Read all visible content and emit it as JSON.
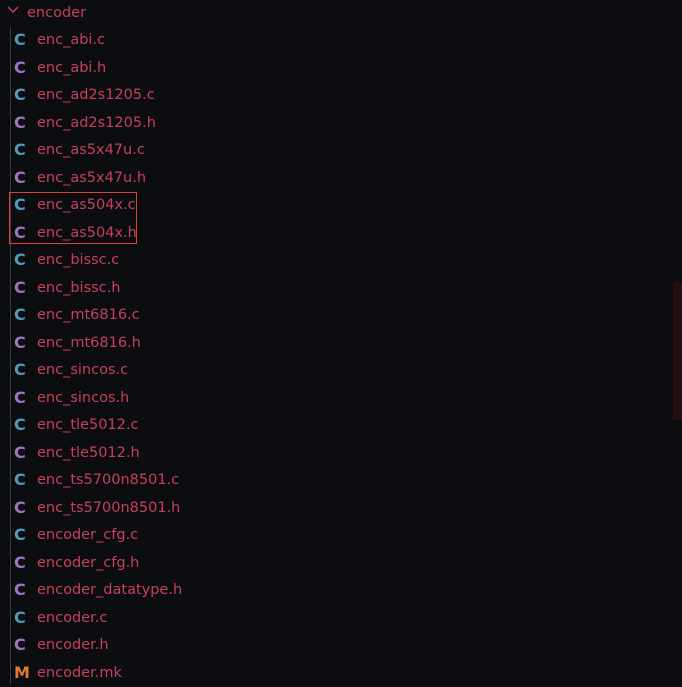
{
  "folder": {
    "name": "encoder",
    "expanded": true
  },
  "colors": {
    "c_source": "#519aba",
    "c_header": "#a074c4",
    "makefile": "#e37933",
    "text": "#c8405a",
    "highlight": "#e0403a"
  },
  "files": [
    {
      "name": "enc_abi.c",
      "icon": "C",
      "type": "c"
    },
    {
      "name": "enc_abi.h",
      "icon": "C",
      "type": "h"
    },
    {
      "name": "enc_ad2s1205.c",
      "icon": "C",
      "type": "c"
    },
    {
      "name": "enc_ad2s1205.h",
      "icon": "C",
      "type": "h"
    },
    {
      "name": "enc_as5x47u.c",
      "icon": "C",
      "type": "c"
    },
    {
      "name": "enc_as5x47u.h",
      "icon": "C",
      "type": "h"
    },
    {
      "name": "enc_as504x.c",
      "icon": "C",
      "type": "c",
      "highlighted": true
    },
    {
      "name": "enc_as504x.h",
      "icon": "C",
      "type": "h",
      "highlighted": true
    },
    {
      "name": "enc_bissc.c",
      "icon": "C",
      "type": "c"
    },
    {
      "name": "enc_bissc.h",
      "icon": "C",
      "type": "h"
    },
    {
      "name": "enc_mt6816.c",
      "icon": "C",
      "type": "c"
    },
    {
      "name": "enc_mt6816.h",
      "icon": "C",
      "type": "h"
    },
    {
      "name": "enc_sincos.c",
      "icon": "C",
      "type": "c"
    },
    {
      "name": "enc_sincos.h",
      "icon": "C",
      "type": "h"
    },
    {
      "name": "enc_tle5012.c",
      "icon": "C",
      "type": "c"
    },
    {
      "name": "enc_tle5012.h",
      "icon": "C",
      "type": "h"
    },
    {
      "name": "enc_ts5700n8501.c",
      "icon": "C",
      "type": "c"
    },
    {
      "name": "enc_ts5700n8501.h",
      "icon": "C",
      "type": "h"
    },
    {
      "name": "encoder_cfg.c",
      "icon": "C",
      "type": "c"
    },
    {
      "name": "encoder_cfg.h",
      "icon": "C",
      "type": "h"
    },
    {
      "name": "encoder_datatype.h",
      "icon": "C",
      "type": "h"
    },
    {
      "name": "encoder.c",
      "icon": "C",
      "type": "c"
    },
    {
      "name": "encoder.h",
      "icon": "C",
      "type": "h"
    },
    {
      "name": "encoder.mk",
      "icon": "M",
      "type": "mk"
    }
  ]
}
